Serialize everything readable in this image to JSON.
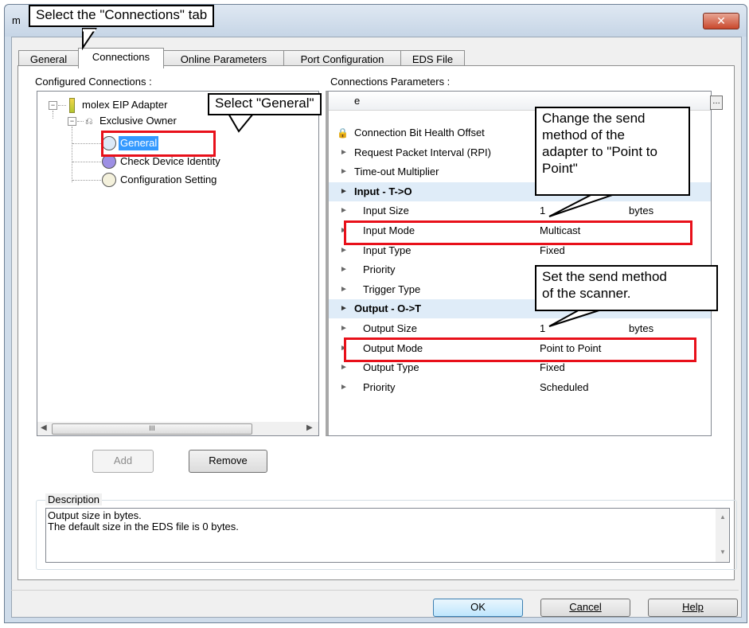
{
  "window": {
    "title": "m",
    "close_glyph": "✕"
  },
  "tabs": [
    {
      "label": "General",
      "active": false
    },
    {
      "label": "Connections",
      "active": true
    },
    {
      "label": "Online Parameters",
      "active": false
    },
    {
      "label": "Port Configuration",
      "active": false
    },
    {
      "label": "EDS File",
      "active": false
    }
  ],
  "tree": {
    "heading": "Configured Connections :",
    "root": "molex EIP Adapter",
    "connection": "Exclusive Owner",
    "children": [
      {
        "label": "General",
        "selected": true,
        "circle_color": "#dce9f7"
      },
      {
        "label": "Check Device Identity",
        "selected": false,
        "circle_color": "#9d8fe4"
      },
      {
        "label": "Configuration Setting",
        "selected": false,
        "circle_color": "#f4f1dc"
      }
    ],
    "scroll_thumb_grip": "III"
  },
  "params": {
    "heading": "Connections Parameters :",
    "header_name": "e",
    "rows": [
      {
        "name": "Connection Bit Health Offset",
        "value": "",
        "unit": "",
        "type": "lock"
      },
      {
        "name": "Request Packet Interval (RPI)",
        "value": "",
        "unit": "",
        "type": "item"
      },
      {
        "name": "Time-out Multiplier",
        "value": "",
        "unit": "",
        "type": "item"
      },
      {
        "name": "Input  -  T->O",
        "value": "",
        "unit": "",
        "type": "group"
      },
      {
        "name": "Input Size",
        "value": "1",
        "unit": "bytes",
        "type": "sub"
      },
      {
        "name": "Input Mode",
        "value": "Multicast",
        "unit": "",
        "type": "sub"
      },
      {
        "name": "Input Type",
        "value": "Fixed",
        "unit": "",
        "type": "sub"
      },
      {
        "name": "Priority",
        "value": "",
        "unit": "",
        "type": "sub"
      },
      {
        "name": "Trigger Type",
        "value": "",
        "unit": "",
        "type": "sub"
      },
      {
        "name": "Output  -  O->T",
        "value": "",
        "unit": "",
        "type": "group"
      },
      {
        "name": "Output Size",
        "value": "1",
        "unit": "bytes",
        "type": "sub"
      },
      {
        "name": "Output Mode",
        "value": "Point to Point",
        "unit": "",
        "type": "sub"
      },
      {
        "name": "Output Type",
        "value": "Fixed",
        "unit": "",
        "type": "sub"
      },
      {
        "name": "Priority",
        "value": "Scheduled",
        "unit": "",
        "type": "sub"
      }
    ]
  },
  "buttons": {
    "add": "Add",
    "remove": "Remove",
    "ok": "OK",
    "cancel": "Cancel",
    "help": "Help"
  },
  "description": {
    "legend": "Description",
    "line1": "Output size in bytes.",
    "line2": "The default size in the EDS file is 0 bytes."
  },
  "annotations": {
    "tab_callout": "Select the \"Connections\" tab",
    "general_callout": "Select \"General\"",
    "adapter_callout": [
      "Change the send",
      "method of the",
      "adapter to \"Point to",
      "Point\""
    ],
    "scanner_callout": [
      "Set the send method",
      "of the scanner."
    ],
    "highlight_color": "#e8101a"
  }
}
